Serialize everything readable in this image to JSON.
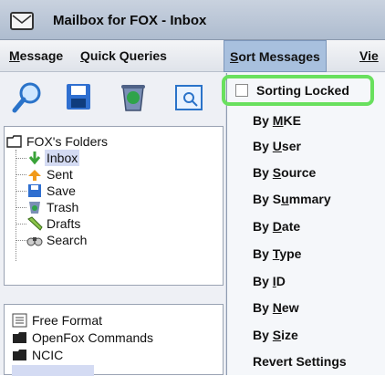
{
  "window": {
    "title": "Mailbox for FOX - Inbox"
  },
  "menubar": {
    "items": [
      {
        "mnemonic": "M",
        "rest": "essage"
      },
      {
        "mnemonic": "Q",
        "rest": "uick Queries"
      },
      {
        "mnemonic": "S",
        "rest": "ort Messages"
      },
      {
        "mnemonic": "Vie",
        "rest": ""
      }
    ]
  },
  "toolbar": {
    "buttons": [
      "search-icon",
      "save-icon",
      "trash-icon",
      "preview-icon"
    ]
  },
  "folders": {
    "root": "FOX's Folders",
    "items": [
      {
        "label": "Inbox",
        "icon": "inbox-arrow-icon",
        "selected": true
      },
      {
        "label": "Sent",
        "icon": "sent-arrow-icon"
      },
      {
        "label": "Save",
        "icon": "save-icon"
      },
      {
        "label": "Trash",
        "icon": "trash-icon"
      },
      {
        "label": "Drafts",
        "icon": "drafts-pencil-icon"
      },
      {
        "label": "Search",
        "icon": "search-binoculars-icon"
      }
    ]
  },
  "queries": {
    "items": [
      "Free Format",
      "OpenFox Commands",
      "NCIC"
    ]
  },
  "sort_menu": {
    "sorting_locked": {
      "label": "Sorting Locked",
      "checked": false
    },
    "items": [
      {
        "prefix": "By ",
        "mnemonic": "M",
        "rest": "KE"
      },
      {
        "prefix": "By ",
        "mnemonic": "U",
        "rest": "ser"
      },
      {
        "prefix": "By ",
        "mnemonic": "S",
        "rest": "ource"
      },
      {
        "prefix": "By S",
        "mnemonic": "u",
        "rest": "mmary"
      },
      {
        "prefix": "By ",
        "mnemonic": "D",
        "rest": "ate"
      },
      {
        "prefix": "By ",
        "mnemonic": "T",
        "rest": "ype"
      },
      {
        "prefix": "By ",
        "mnemonic": "I",
        "rest": "D"
      },
      {
        "prefix": "By ",
        "mnemonic": "N",
        "rest": "ew"
      },
      {
        "prefix": "By ",
        "mnemonic": "S",
        "rest": "ize"
      }
    ],
    "revert": "Revert Settings"
  },
  "colors": {
    "highlight_border": "#69e05e",
    "menu_open_bg": "#a8c0de",
    "selection_bg": "#d4dbf3"
  }
}
